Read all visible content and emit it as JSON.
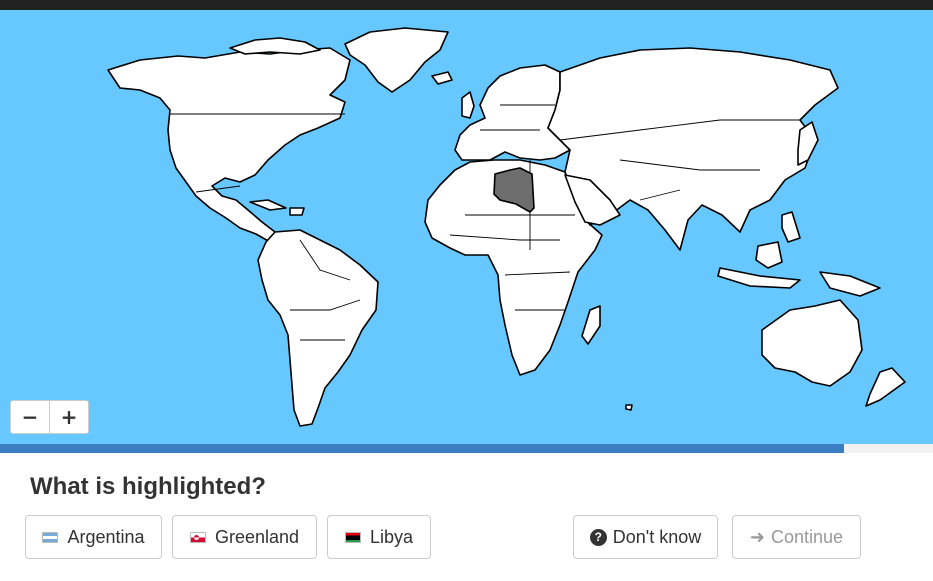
{
  "quiz": {
    "question": "What is highlighted?",
    "answers": [
      {
        "label": "Argentina",
        "flag_icon": "argentina-flag-icon"
      },
      {
        "label": "Greenland",
        "flag_icon": "greenland-flag-icon"
      },
      {
        "label": "Libya",
        "flag_icon": "libya-flag-icon"
      }
    ],
    "dont_know_label": "Don't know",
    "continue_label": "Continue",
    "continue_enabled": false,
    "progress_fraction": 0.905
  },
  "map": {
    "highlighted_country": "Libya",
    "zoom_out_label": "−",
    "zoom_in_label": "+"
  },
  "colors": {
    "ocean": "#66c8ff",
    "land": "#ffffff",
    "highlight": "#6e6e6e",
    "progress": "#3a7fc1"
  }
}
